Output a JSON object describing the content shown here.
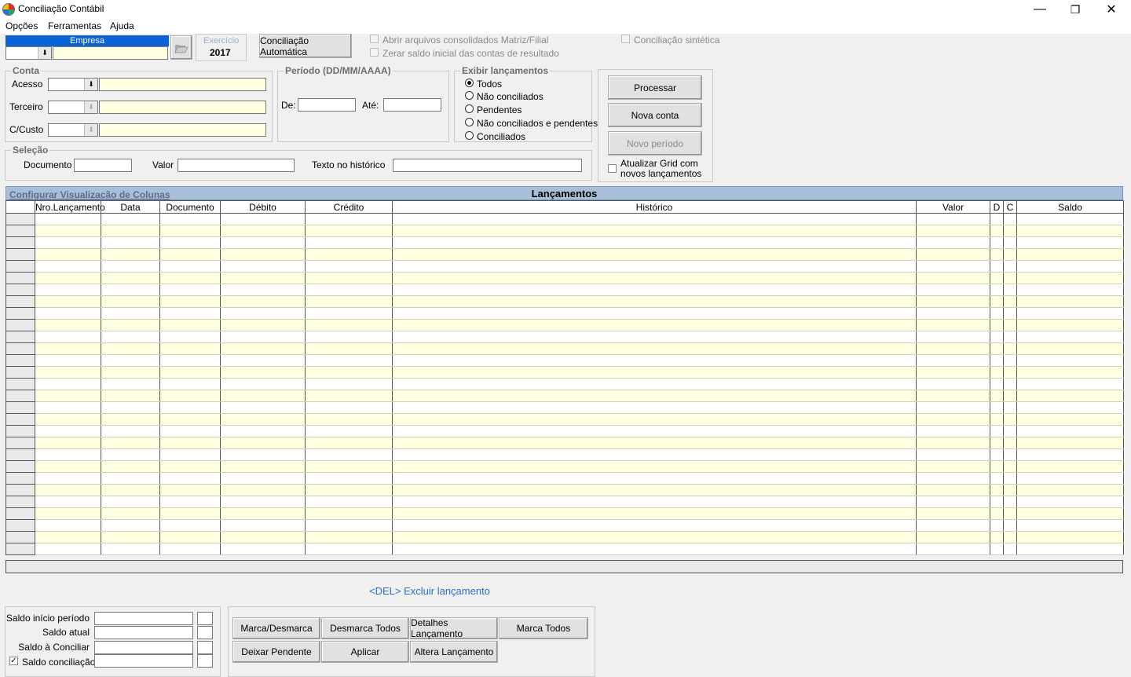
{
  "window": {
    "title": "Conciliação Contábil",
    "minimize": "—",
    "restore": "❐",
    "close": "✕"
  },
  "menu": [
    "Opções",
    "Ferramentas",
    "Ajuda"
  ],
  "empresa": {
    "label": "Empresa",
    "code_value": "",
    "name_value": ""
  },
  "exercicio": {
    "label": "Exercício",
    "value": "2017"
  },
  "buttons": {
    "conciliacao_automatica": "Conciliação Automática",
    "processar": "Processar",
    "nova_conta": "Nova conta",
    "novo_periodo": "Novo período"
  },
  "options": {
    "abrir_consolidados": "Abrir arquivos consolidados Matriz/Filial",
    "zerar_saldo": "Zerar saldo inicial das contas de resultado",
    "conciliacao_sintetica": "Conciliação sintética"
  },
  "conta": {
    "legend": "Conta",
    "acesso": "Acesso",
    "terceiro": "Terceiro",
    "ccusto": "C/Custo"
  },
  "periodo": {
    "legend": "Período (DD/MM/AAAA)",
    "de": "De:",
    "ate": "Até:"
  },
  "exibir": {
    "legend": "Exibir lançamentos",
    "items": [
      "Todos",
      "Não conciliados",
      "Pendentes",
      "Não conciliados e pendentes",
      "Conciliados"
    ],
    "selected": 0
  },
  "atualizar_grid": "Atualizar Grid com novos lançamentos",
  "selecao": {
    "legend": "Seleção",
    "documento": "Documento",
    "valor": "Valor",
    "texto": "Texto no histórico"
  },
  "grid": {
    "config_link": "Configurar Visualização de Colunas",
    "title": "Lançamentos",
    "columns": [
      "",
      "Nro.Lançamento",
      "Data",
      "Documento",
      "Débito",
      "Crédito",
      "Histórico",
      "Valor",
      "D",
      "C",
      "Saldo"
    ]
  },
  "del_hint": "<DEL> Excluir lançamento",
  "saldos": {
    "inicio": "Saldo início período",
    "atual": "Saldo atual",
    "a_conciliar": "Saldo à Conciliar",
    "conciliacao": "Saldo conciliação"
  },
  "actions": {
    "marca_desmarca": "Marca/Desmarca",
    "desmarca_todos": "Desmarca Todos",
    "detalhes": "Detalhes Lançamento",
    "marca_todos": "Marca Todos",
    "deixar_pendente": "Deixar Pendente",
    "aplicar": "Aplicar",
    "altera": "Altera Lançamento"
  }
}
